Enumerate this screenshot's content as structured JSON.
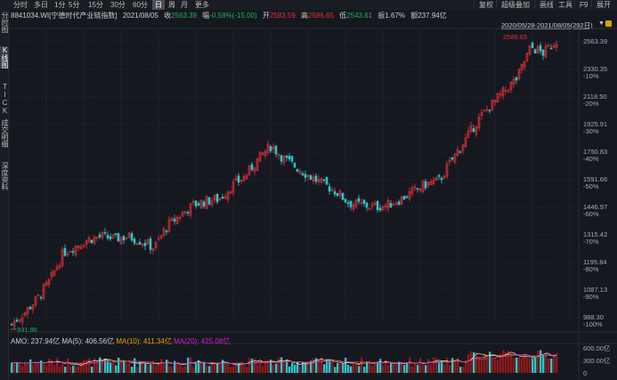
{
  "period_tabs": [
    "分时",
    "多日",
    "1分",
    "5分",
    "15分",
    "30分",
    "60分",
    "日",
    "周",
    "月",
    "更多"
  ],
  "active_period": "日",
  "right_tabs": [
    "复权",
    "超级叠加",
    "画线",
    "工具",
    "F9",
    "展开"
  ],
  "side_tabs": [
    "分时图",
    "K线图",
    "TICK",
    "成交明细",
    "深度资料"
  ],
  "active_side": "K线图",
  "info": {
    "code": "8841034.WI[宁德时代产业链指数]",
    "date": "2021/08/05",
    "close_label": "收",
    "close": "2563.39",
    "chg_label": "幅",
    "chg": "-0.58%(-15.00)",
    "open_label": "开",
    "open": "2583.59",
    "high_label": "高",
    "high": "2586.65",
    "low_label": "低",
    "low": "2543.61",
    "amp_label": "振",
    "amp": "1.67%",
    "amt_label": "额",
    "amt": "237.94亿"
  },
  "range": "2020/05/28-2021/08/05(292日)",
  "volume_legend": {
    "amo": "AMO: 237.94亿",
    "ma5": "MA(5): 406.56亿",
    "ma10": "MA(10): 411.34亿",
    "ma20": "MA(20): 425.08亿"
  },
  "colors": {
    "up": "#e0303a",
    "down": "#2ec4c9",
    "ma5": "#e8e8e8",
    "ma10": "#e0a000",
    "ma20": "#d020d0"
  },
  "chart_data": {
    "type": "candlestick",
    "price_axis": [
      {
        "v": "2563.39",
        "p": ""
      },
      {
        "v": "2330.35",
        "p": "-10%"
      },
      {
        "v": "2118.50",
        "p": "-20%"
      },
      {
        "v": "1925.91",
        "p": "-30%"
      },
      {
        "v": "1750.83",
        "p": "-40%"
      },
      {
        "v": "1591.66",
        "p": "-50%"
      },
      {
        "v": "1446.97",
        "p": "-60%"
      },
      {
        "v": "1315.42",
        "p": "-70%"
      },
      {
        "v": "1195.84",
        "p": "-80%"
      },
      {
        "v": "1087.13",
        "p": "-90%"
      },
      {
        "v": "988.30",
        "p": "-100%"
      }
    ],
    "volume_axis": [
      "600.00亿",
      "300.00亿",
      "0"
    ],
    "max_label": "2586.65",
    "min_label": "931.96",
    "ymin": 931.96,
    "ymax": 2586.65,
    "close_path": [
      960,
      1000,
      1050,
      1120,
      1230,
      1260,
      1290,
      1300,
      1290,
      1300,
      1280,
      1250,
      1350,
      1400,
      1450,
      1470,
      1480,
      1550,
      1600,
      1700,
      1780,
      1700,
      1650,
      1600,
      1560,
      1520,
      1460,
      1450,
      1440,
      1450,
      1480,
      1520,
      1560,
      1580,
      1700,
      1820,
      1950,
      2050,
      2150,
      2250,
      2500,
      2450,
      2563
    ]
  }
}
